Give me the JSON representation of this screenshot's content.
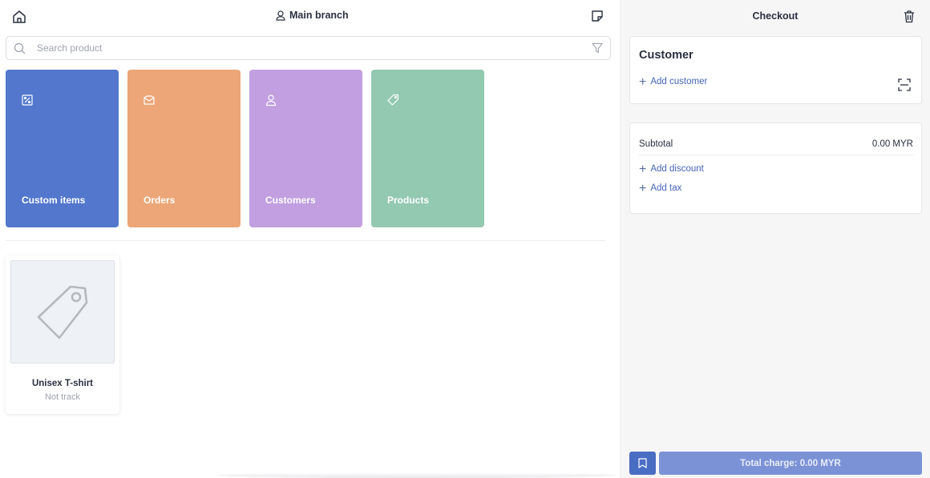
{
  "header": {
    "branch_label": "Main branch"
  },
  "search": {
    "placeholder": "Search product",
    "value": ""
  },
  "tiles": [
    {
      "label": "Custom items",
      "color": "#5277cc",
      "icon": "custom-items-icon"
    },
    {
      "label": "Orders",
      "color": "#eca677",
      "icon": "orders-icon"
    },
    {
      "label": "Customers",
      "color": "#c19fe0",
      "icon": "customers-icon"
    },
    {
      "label": "Products",
      "color": "#93c9b1",
      "icon": "products-icon"
    }
  ],
  "products": [
    {
      "name": "Unisex T-shirt",
      "stock": "Not track",
      "icon": "price-tag-icon"
    }
  ],
  "checkout": {
    "title": "Checkout",
    "customer": {
      "title": "Customer",
      "add_label": "Add customer"
    },
    "totals": {
      "subtotal_label": "Subtotal",
      "subtotal_value": "0.00 MYR",
      "add_discount_label": "Add discount",
      "add_tax_label": "Add tax"
    },
    "charge_label": "Total charge: 0.00 MYR"
  },
  "colors": {
    "accent": "#4a6dc4",
    "charge_button": "#7b93d6",
    "link": "#4465b8"
  }
}
